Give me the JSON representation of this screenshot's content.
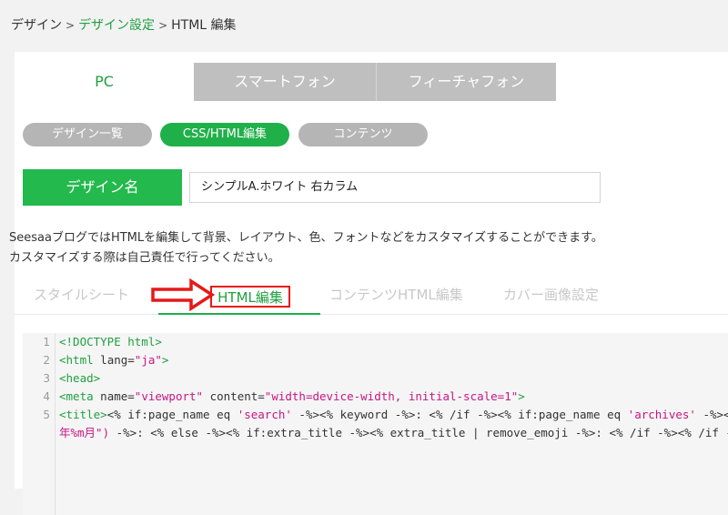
{
  "breadcrumb": {
    "item1": "デザイン",
    "item2": "デザイン設定",
    "item3": "HTML 編集",
    "separator": ">"
  },
  "device_tabs": {
    "pc": "PC",
    "smartphone": "スマートフォン",
    "featurephone": "フィーチャフォン",
    "active": "pc"
  },
  "pills": {
    "design_list": "デザイン一覧",
    "css_html": "CSS/HTML編集",
    "contents": "コンテンツ",
    "active": "css_html"
  },
  "design_name": {
    "label": "デザイン名",
    "value": "シンプルA.ホワイト 右カラム"
  },
  "description": {
    "line1": "SeesaaブログではHTMLを編集して背景、レイアウト、色、フォントなどをカスタマイズすることができます。",
    "line2": "カスタマイズする際は自己責任で行ってください。"
  },
  "sub_tabs": {
    "stylesheet": "スタイルシート",
    "html_edit": "HTML編集",
    "content_html": "コンテンツHTML編集",
    "cover_image": "カバー画像設定",
    "active": "html_edit"
  },
  "code": {
    "line_numbers": [
      "1",
      "2",
      "3",
      "4",
      "5",
      ""
    ],
    "line1": "<!DOCTYPE html>",
    "line2_open": "<html",
    "line2_attr": " lang=",
    "line2_val": "\"ja\"",
    "line2_close": ">",
    "line3": "<head>",
    "line4_open": "<meta",
    "line4_attr1": " name=",
    "line4_val1": "\"viewport\"",
    "line4_attr2": " content=",
    "line4_val2": "\"width=device-width, initial-scale=1\"",
    "line4_close": ">",
    "line5_open": "<title>",
    "line5_a": "<% if:page_name eq ",
    "line5_b": "'search'",
    "line5_c": " -%><% keyword -%>: <% /if -%><% if:page_name eq ",
    "line5_d": "'archives'",
    "line5_e": " -%><",
    "line6_a": "年%m月\")",
    "line6_b": " -%>: <% else -%><% if:extra_title -%><% extra_title | remove_emoji -%>: <% /if -%><% /if -"
  },
  "colors": {
    "accent": "#20b04a",
    "highlight_border": "#e61919",
    "arrow": "#e61919"
  }
}
